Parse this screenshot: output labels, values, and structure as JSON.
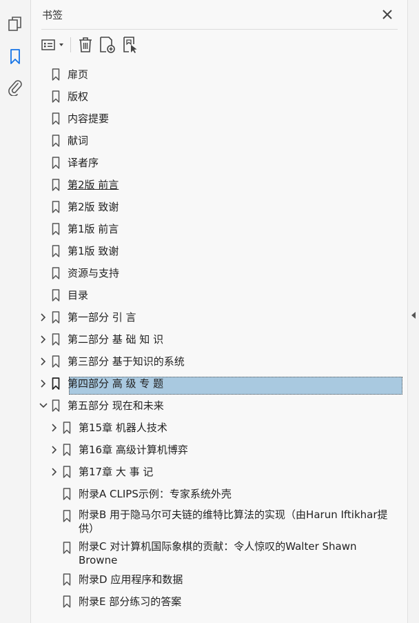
{
  "panel": {
    "title": "书签"
  },
  "toolbar": {
    "options_icon": "options-icon",
    "delete_icon": "trash-icon",
    "new_bookmark_icon": "add-bookmark-icon",
    "bookmark_from_selection_icon": "bookmark-from-structure-icon"
  },
  "colors": {
    "selected_bg": "#a9c9e0",
    "accent": "#1473e6"
  },
  "bookmarks": [
    {
      "label": "扉页",
      "level": 0,
      "expander": "none"
    },
    {
      "label": "版权",
      "level": 0,
      "expander": "none"
    },
    {
      "label": "内容提要",
      "level": 0,
      "expander": "none"
    },
    {
      "label": "献词",
      "level": 0,
      "expander": "none"
    },
    {
      "label": "译者序",
      "level": 0,
      "expander": "none"
    },
    {
      "label": "第2版  前言",
      "level": 0,
      "expander": "none",
      "underline": true
    },
    {
      "label": "第2版  致谢",
      "level": 0,
      "expander": "none"
    },
    {
      "label": "第1版  前言",
      "level": 0,
      "expander": "none"
    },
    {
      "label": "第1版  致谢",
      "level": 0,
      "expander": "none"
    },
    {
      "label": "资源与支持",
      "level": 0,
      "expander": "none"
    },
    {
      "label": "目录",
      "level": 0,
      "expander": "none"
    },
    {
      "label": "第一部分 引 言",
      "level": 0,
      "expander": "collapsed"
    },
    {
      "label": "第二部分 基 础 知 识",
      "level": 0,
      "expander": "collapsed"
    },
    {
      "label": "第三部分 基于知识的系统",
      "level": 0,
      "expander": "collapsed"
    },
    {
      "label": "第四部分 高 级 专 题",
      "level": 0,
      "expander": "collapsed",
      "selected": true
    },
    {
      "label": "第五部分 现在和未来",
      "level": 0,
      "expander": "expanded"
    },
    {
      "label": "第15章  机器人技术",
      "level": 1,
      "expander": "collapsed"
    },
    {
      "label": "第16章  高级计算机博弈",
      "level": 1,
      "expander": "collapsed"
    },
    {
      "label": "第17章  大  事  记",
      "level": 1,
      "expander": "collapsed"
    },
    {
      "label": "附录A  CLIPS示例：专家系统外壳",
      "level": 1,
      "expander": "none"
    },
    {
      "label": "附录B  用于隐马尔可夫链的维特比算法的实现（由Harun Iftikhar提供）",
      "level": 1,
      "expander": "none",
      "wrap": true
    },
    {
      "label": "附录C  对计算机国际象棋的贡献：令人惊叹的Walter Shawn Browne",
      "level": 1,
      "expander": "none",
      "wrap": true
    },
    {
      "label": "附录D  应用程序和数据",
      "level": 1,
      "expander": "none"
    },
    {
      "label": "附录E  部分练习的答案",
      "level": 1,
      "expander": "none"
    }
  ]
}
